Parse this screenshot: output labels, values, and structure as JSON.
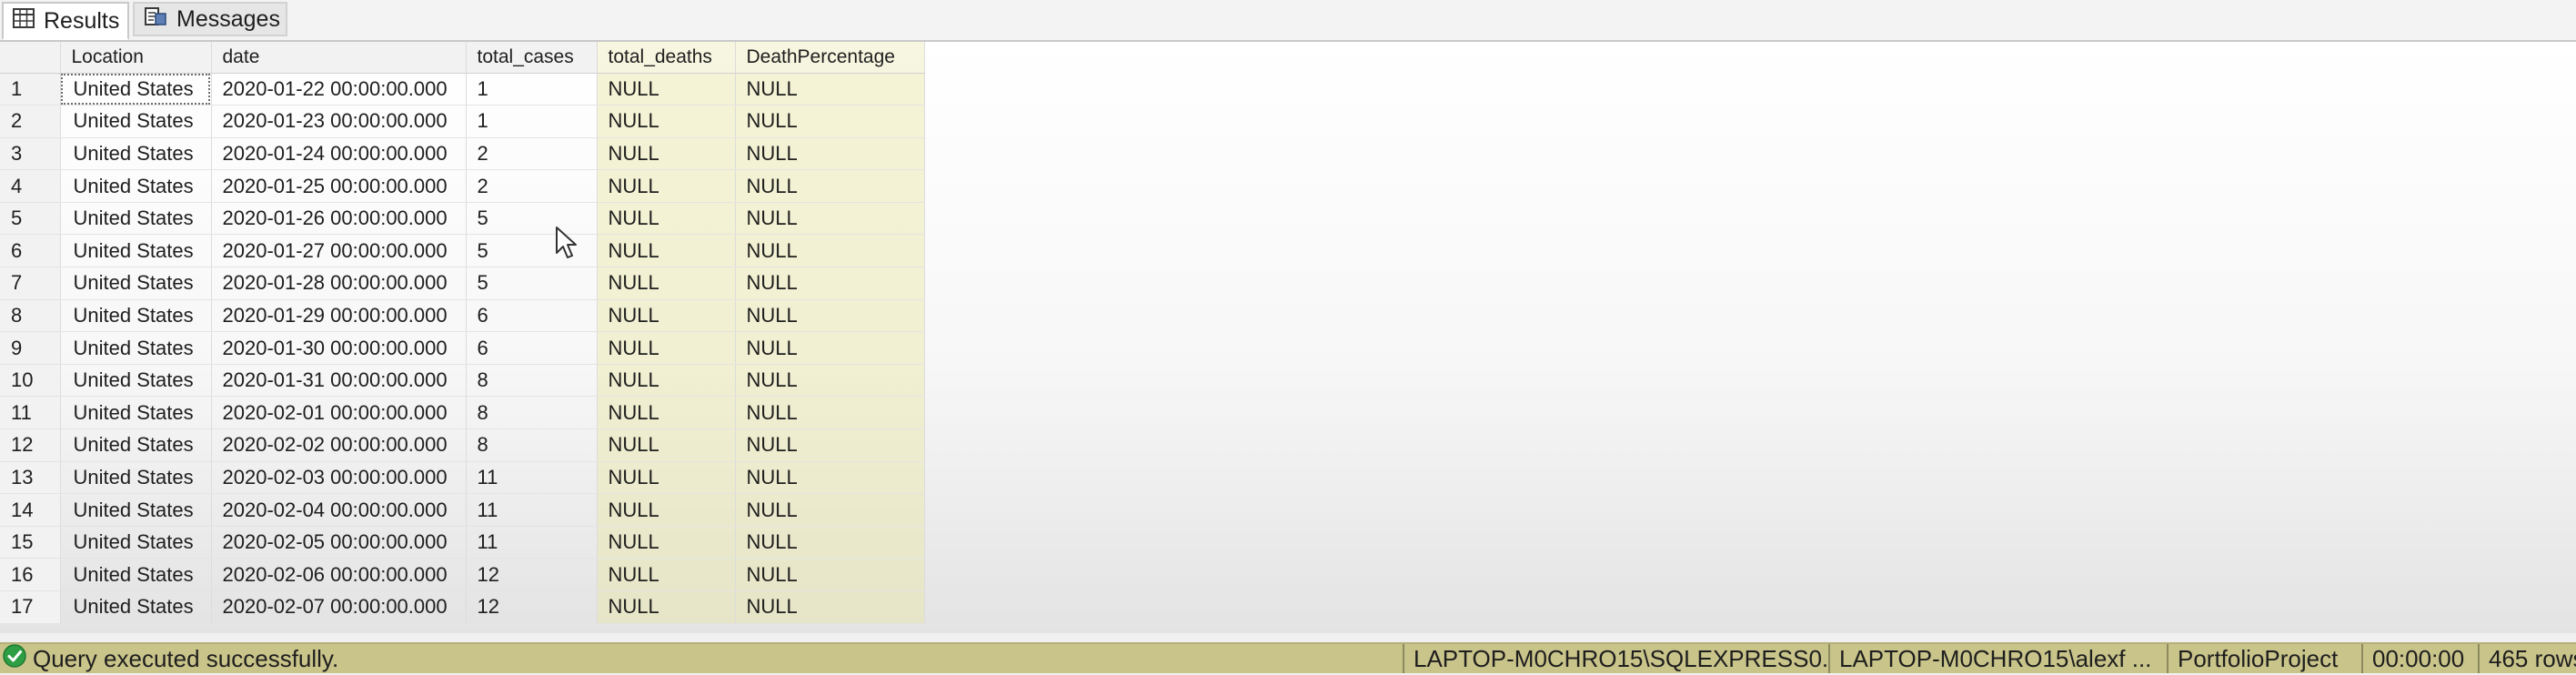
{
  "tabs": {
    "results_label": "Results",
    "messages_label": "Messages"
  },
  "grid": {
    "columns": [
      "Location",
      "date",
      "total_cases",
      "total_deaths",
      "DeathPercentage"
    ],
    "rows": [
      [
        "1",
        "United States",
        "2020-01-22 00:00:00.000",
        "1",
        "NULL",
        "NULL"
      ],
      [
        "2",
        "United States",
        "2020-01-23 00:00:00.000",
        "1",
        "NULL",
        "NULL"
      ],
      [
        "3",
        "United States",
        "2020-01-24 00:00:00.000",
        "2",
        "NULL",
        "NULL"
      ],
      [
        "4",
        "United States",
        "2020-01-25 00:00:00.000",
        "2",
        "NULL",
        "NULL"
      ],
      [
        "5",
        "United States",
        "2020-01-26 00:00:00.000",
        "5",
        "NULL",
        "NULL"
      ],
      [
        "6",
        "United States",
        "2020-01-27 00:00:00.000",
        "5",
        "NULL",
        "NULL"
      ],
      [
        "7",
        "United States",
        "2020-01-28 00:00:00.000",
        "5",
        "NULL",
        "NULL"
      ],
      [
        "8",
        "United States",
        "2020-01-29 00:00:00.000",
        "6",
        "NULL",
        "NULL"
      ],
      [
        "9",
        "United States",
        "2020-01-30 00:00:00.000",
        "6",
        "NULL",
        "NULL"
      ],
      [
        "10",
        "United States",
        "2020-01-31 00:00:00.000",
        "8",
        "NULL",
        "NULL"
      ],
      [
        "11",
        "United States",
        "2020-02-01 00:00:00.000",
        "8",
        "NULL",
        "NULL"
      ],
      [
        "12",
        "United States",
        "2020-02-02 00:00:00.000",
        "8",
        "NULL",
        "NULL"
      ],
      [
        "13",
        "United States",
        "2020-02-03 00:00:00.000",
        "11",
        "NULL",
        "NULL"
      ],
      [
        "14",
        "United States",
        "2020-02-04 00:00:00.000",
        "11",
        "NULL",
        "NULL"
      ],
      [
        "15",
        "United States",
        "2020-02-05 00:00:00.000",
        "11",
        "NULL",
        "NULL"
      ],
      [
        "16",
        "United States",
        "2020-02-06 00:00:00.000",
        "12",
        "NULL",
        "NULL"
      ],
      [
        "17",
        "United States",
        "2020-02-07 00:00:00.000",
        "12",
        "NULL",
        "NULL"
      ]
    ]
  },
  "status": {
    "message": "Query executed successfully.",
    "server": "LAPTOP-M0CHRO15\\SQLEXPRESS0...",
    "user": "LAPTOP-M0CHRO15\\alexf ...",
    "database": "PortfolioProject",
    "elapsed": "00:00:00",
    "row_count": "465 rows",
    "success_color": "#2e9e44",
    "bar_color": "#c9c48a"
  },
  "icons": {
    "results_tab": "grid-table-icon",
    "messages_tab": "messages-icon",
    "status": "check-circle-icon",
    "pointer": "mouse-cursor-icon"
  }
}
